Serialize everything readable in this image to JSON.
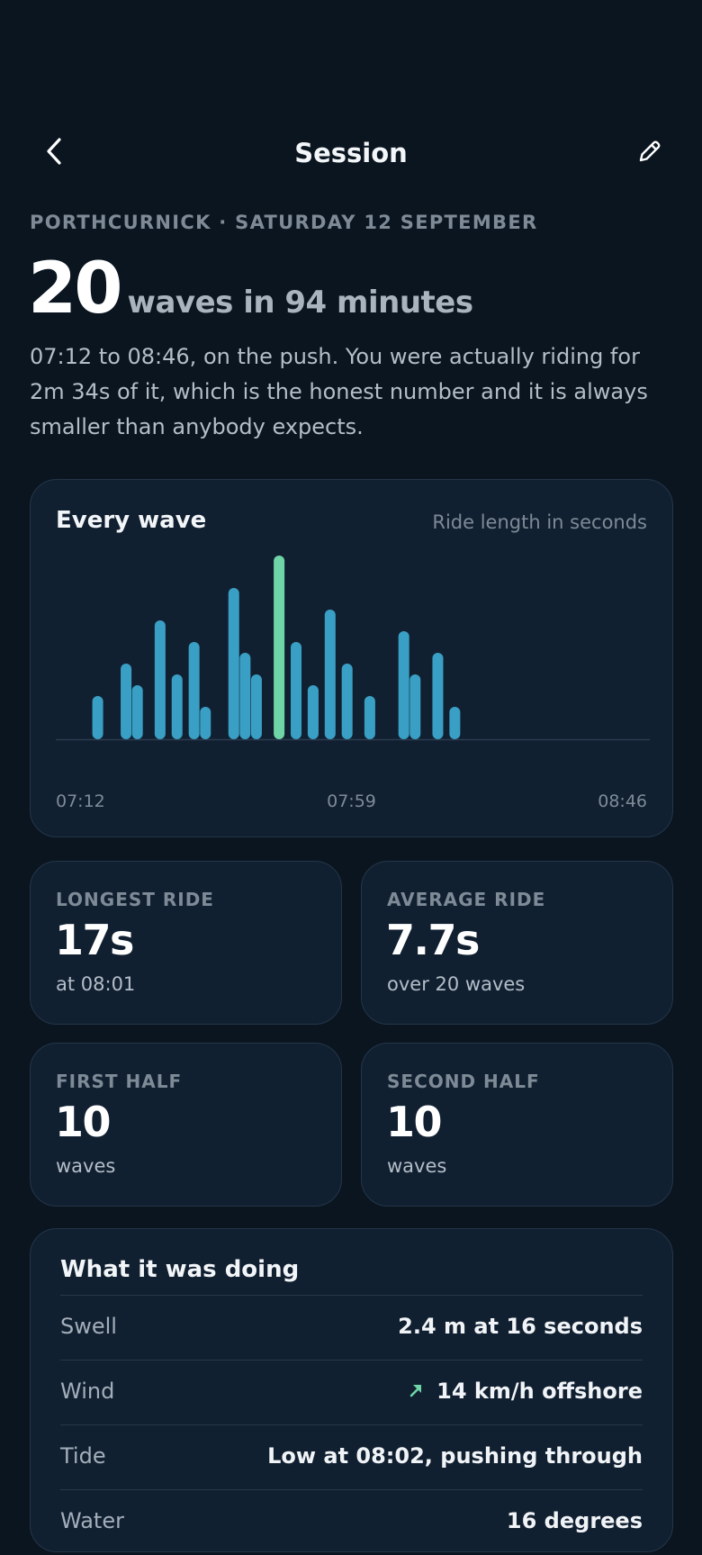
{
  "header": {
    "title": "Session",
    "back_icon": "chevron-left-icon",
    "edit_icon": "pencil-icon"
  },
  "session": {
    "location_date": "PORTHCURNICK · SATURDAY 12 SEPTEMBER",
    "wave_count": "20",
    "wave_label": "waves in 94 minutes",
    "summary": "07:12 to 08:46, on the push. You were actually riding for 2m 34s of it, which is the honest number and it is always smaller than anybody expects."
  },
  "chart": {
    "title": "Every wave",
    "subtitle": "Ride length in seconds",
    "x_ticks": [
      "07:12",
      "07:59",
      "08:46"
    ]
  },
  "chart_data": {
    "type": "bar",
    "title": "Every wave",
    "ylabel": "Ride length in seconds",
    "x_tick_labels": [
      "07:12",
      "07:59",
      "08:46"
    ],
    "x_range_minutes": [
      0,
      94
    ],
    "wave_minutes": [
      2,
      7,
      9,
      13,
      16,
      19,
      21,
      26,
      28,
      30,
      34,
      37,
      40,
      43,
      46,
      50,
      56,
      58,
      62,
      65
    ],
    "values": [
      4,
      7,
      5,
      11,
      6,
      9,
      3,
      14,
      8,
      6,
      17,
      9,
      5,
      12,
      7,
      4,
      10,
      6,
      8,
      3
    ],
    "highlight_index": 10,
    "colors": {
      "bar": "#3a9fc4",
      "highlight": "#6fd4a6",
      "baseline": "#2a3b4d"
    }
  },
  "stats": [
    {
      "label": "LONGEST RIDE",
      "value": "17s",
      "sub": "at 08:01"
    },
    {
      "label": "AVERAGE RIDE",
      "value": "7.7s",
      "sub": "over 20 waves"
    },
    {
      "label": "FIRST HALF",
      "value": "10",
      "sub": "waves"
    },
    {
      "label": "SECOND HALF",
      "value": "10",
      "sub": "waves"
    }
  ],
  "conditions": {
    "title": "What it was doing",
    "rows": [
      {
        "key": "Swell",
        "value": "2.4 m at 16 seconds"
      },
      {
        "key": "Wind",
        "value": "14 km/h offshore",
        "icon": "wind-direction-arrow-icon"
      },
      {
        "key": "Tide",
        "value": "Low at 08:02, pushing through"
      },
      {
        "key": "Water",
        "value": "16 degrees"
      }
    ]
  },
  "theme": {
    "background": "#0a1520",
    "card": "#112031",
    "accent": "#3a9fc4",
    "highlight": "#6fd4a6"
  }
}
